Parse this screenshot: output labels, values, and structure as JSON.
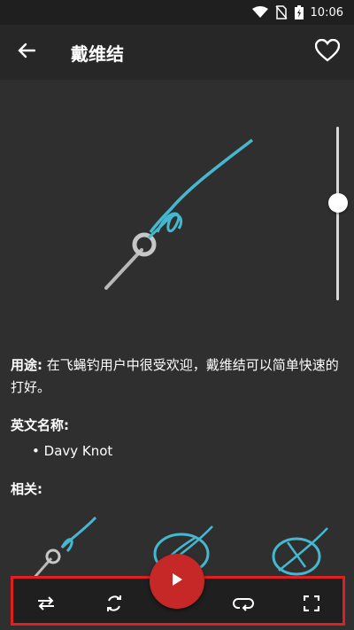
{
  "status_bar": {
    "time": "10:06"
  },
  "app_bar": {
    "title": "戴维结"
  },
  "usage": {
    "label": "用途:",
    "text": " 在飞蝇钓用户中很受欢迎，戴维结可以简单快速的打好。"
  },
  "english_name": {
    "label": "英文名称:",
    "bullet": "•",
    "value": "Davy Knot"
  },
  "related": {
    "label": "相关:"
  },
  "colors": {
    "accent_rope": "#45b8d0",
    "play_button": "#c62828",
    "highlight": "#e02020"
  },
  "icons": {
    "back": "arrow-left-icon",
    "favorite": "heart-outline-icon",
    "swap": "swap-arrows-icon",
    "refresh": "refresh-icon",
    "play": "play-icon",
    "loop": "loop-icon",
    "fullscreen": "fullscreen-icon"
  }
}
